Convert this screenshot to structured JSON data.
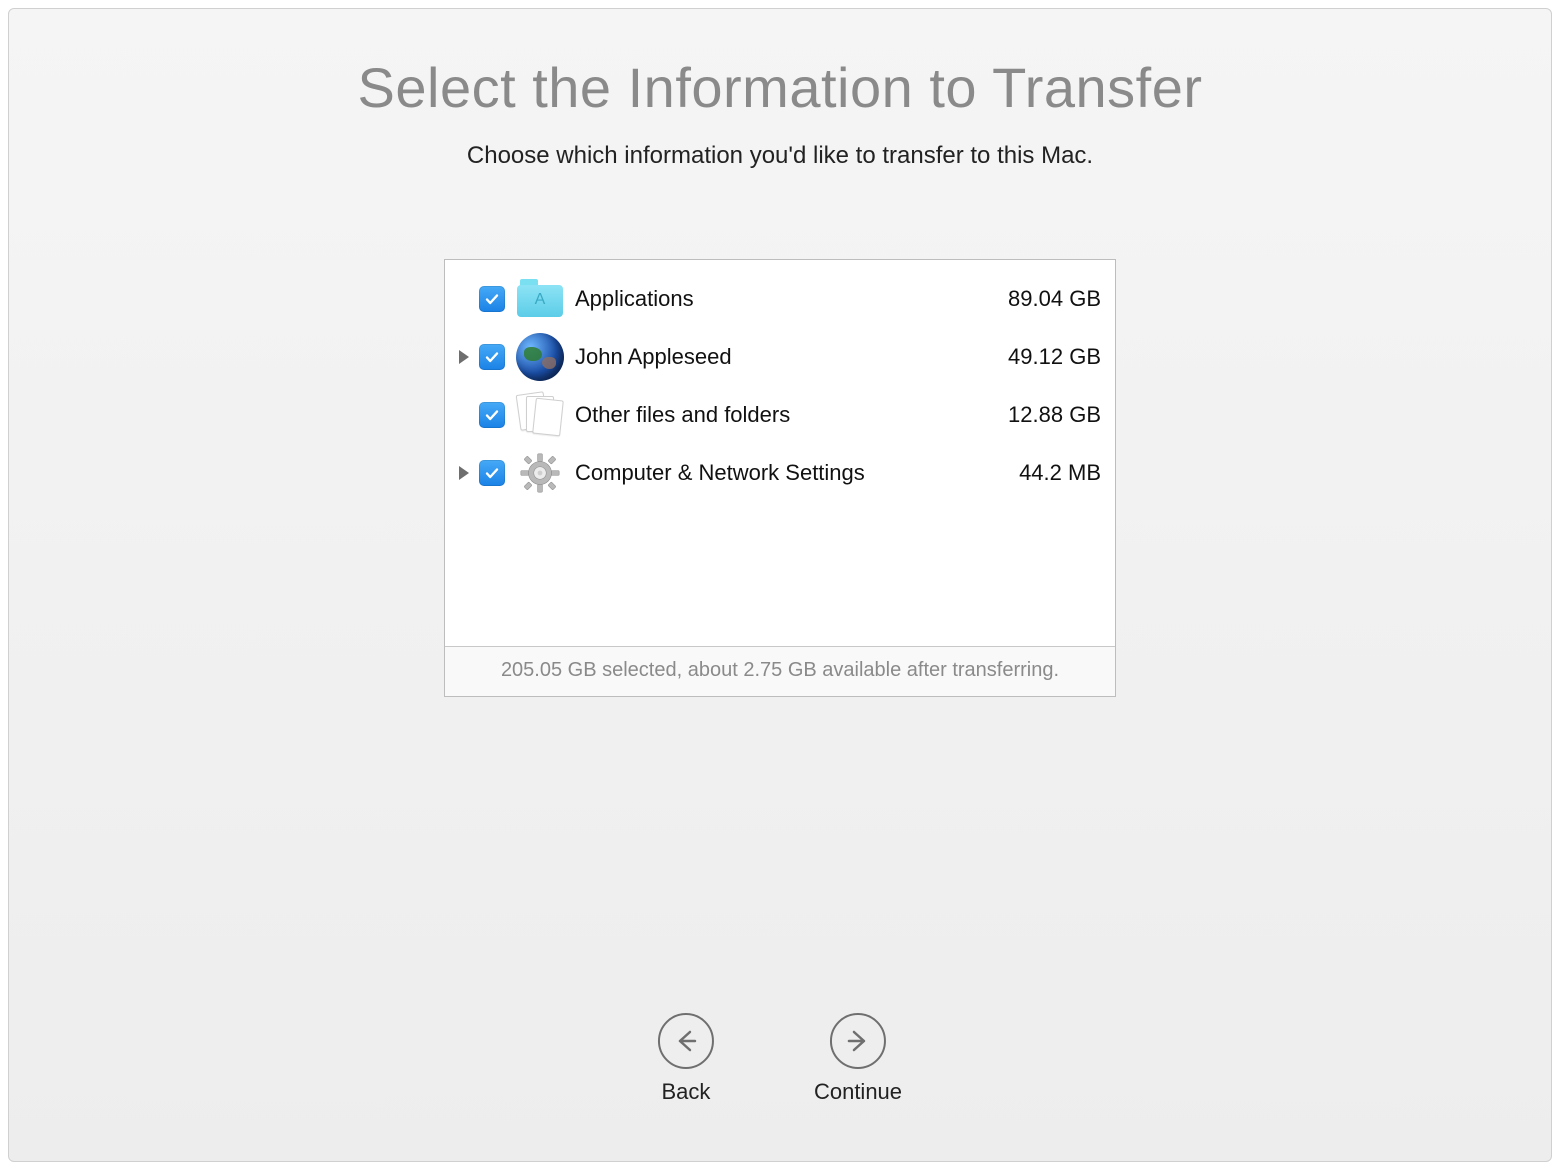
{
  "title": "Select the Information to Transfer",
  "subtitle": "Choose which information you'd like to transfer to this Mac.",
  "items": [
    {
      "label": "Applications",
      "size": "89.04 GB",
      "checked": true,
      "expandable": false
    },
    {
      "label": "John Appleseed",
      "size": "49.12 GB",
      "checked": true,
      "expandable": true
    },
    {
      "label": "Other files and folders",
      "size": "12.88 GB",
      "checked": true,
      "expandable": false
    },
    {
      "label": "Computer & Network Settings",
      "size": "44.2 MB",
      "checked": true,
      "expandable": true
    }
  ],
  "status": "205.05 GB selected, about 2.75 GB available after transferring.",
  "nav": {
    "back": "Back",
    "continue": "Continue"
  }
}
